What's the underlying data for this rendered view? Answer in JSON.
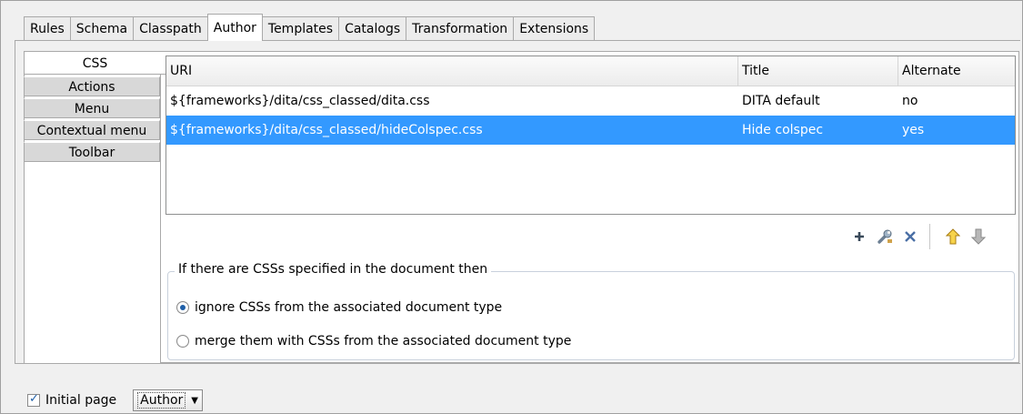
{
  "tabs": [
    "Rules",
    "Schema",
    "Classpath",
    "Author",
    "Templates",
    "Catalogs",
    "Transformation",
    "Extensions"
  ],
  "active_tab": "Author",
  "side_tabs": [
    "CSS",
    "Actions",
    "Menu",
    "Contextual menu",
    "Toolbar"
  ],
  "active_side_tab": "CSS",
  "table": {
    "headers": [
      "URI",
      "Title",
      "Alternate"
    ],
    "rows": [
      [
        "${frameworks}/dita/css_classed/dita.css",
        "DITA default",
        "no"
      ],
      [
        "${frameworks}/dita/css_classed/hideColspec.css",
        "Hide colspec",
        "yes"
      ]
    ],
    "selected_row": 1
  },
  "toolbar": {
    "icons": [
      "add-icon",
      "edit-wrench-icon",
      "delete-icon",
      "move-up-icon",
      "move-down-icon"
    ]
  },
  "group": {
    "legend": "If there are CSSs specified in the document then",
    "options": [
      "ignore CSSs from the associated document type",
      "merge them with CSSs from the associated document type"
    ],
    "selected": 0
  },
  "bottom": {
    "checkbox_label": "Initial page",
    "checkbox_checked": true,
    "combo_value": "Author"
  },
  "colors": {
    "selection": "#3399ff",
    "radio_dot": "#1f5fa8"
  }
}
